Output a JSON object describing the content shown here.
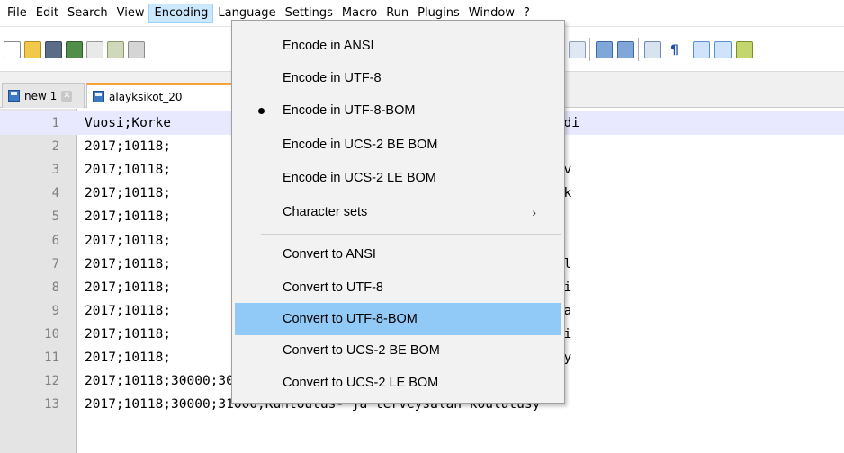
{
  "menubar": {
    "items": [
      "File",
      "Edit",
      "Search",
      "View",
      "Encoding",
      "Language",
      "Settings",
      "Macro",
      "Run",
      "Plugins",
      "Window",
      "?"
    ],
    "active_index": 4
  },
  "tabs": {
    "inactive_label": "new 1",
    "active_label": "alayksikot_20"
  },
  "editor": {
    "lines": [
      {
        "num": "1",
        "text": "Vuosi;Korke                              koodi;Alayksikön koodi"
      },
      {
        "num": "2",
        "text": "2017;10118;                             tuuri yhteiset"
      },
      {
        "num": "3",
        "text": "2017;10118;                              koulutusyksikkö, Kouv"
      },
      {
        "num": "4",
        "text": "2017;10118;                              koulutusyksikkö, Mikk"
      },
      {
        "num": "5",
        "text": "2017;10118;                             lutusyksikkö"
      },
      {
        "num": "6",
        "text": "2017;10118;                             eiset"
      },
      {
        "num": "7",
        "text": "2017;10118;                              energiatekniikan koul"
      },
      {
        "num": "8",
        "text": "2017;10118;                             knologian koulutusyksi"
      },
      {
        "num": "9",
        "text": "2017;10118;                              ja materiaalitekniika"
      },
      {
        "num": "10",
        "text": "2017;10118;                              ja ympäristöteknologi"
      },
      {
        "num": "11",
        "text": "2017;10118;                             a merenkulun koulutusy"
      },
      {
        "num": "12",
        "text": "2017;10118;30000;30000;Hyvinvointi yhteiset"
      },
      {
        "num": "13",
        "text": "2017;10118;30000;31000;Kuntoutus- ja terveysalan koulutusy"
      }
    ]
  },
  "encoding_menu": {
    "items": [
      {
        "label": "Encode in ANSI",
        "checked": false,
        "highlight": false
      },
      {
        "label": "Encode in UTF-8",
        "checked": false,
        "highlight": false
      },
      {
        "label": "Encode in UTF-8-BOM",
        "checked": true,
        "highlight": false
      },
      {
        "label": "Encode in UCS-2 BE BOM",
        "checked": false,
        "highlight": false
      },
      {
        "label": "Encode in UCS-2 LE BOM",
        "checked": false,
        "highlight": false
      },
      {
        "label": "Character sets",
        "checked": false,
        "highlight": false,
        "submenu": true
      },
      {
        "label": "Convert to ANSI",
        "checked": false,
        "highlight": false
      },
      {
        "label": "Convert to UTF-8",
        "checked": false,
        "highlight": false
      },
      {
        "label": "Convert to UTF-8-BOM",
        "checked": false,
        "highlight": true
      },
      {
        "label": "Convert to UCS-2 BE BOM",
        "checked": false,
        "highlight": false
      },
      {
        "label": "Convert to UCS-2 LE BOM",
        "checked": false,
        "highlight": false
      }
    ],
    "submenu_arrow": "›"
  },
  "colors": {
    "active_tab_accent": "#f7a23a",
    "menu_highlight": "#91c9f7",
    "menubar_active": "#cce8ff",
    "gutter": "#e4e4e4"
  }
}
